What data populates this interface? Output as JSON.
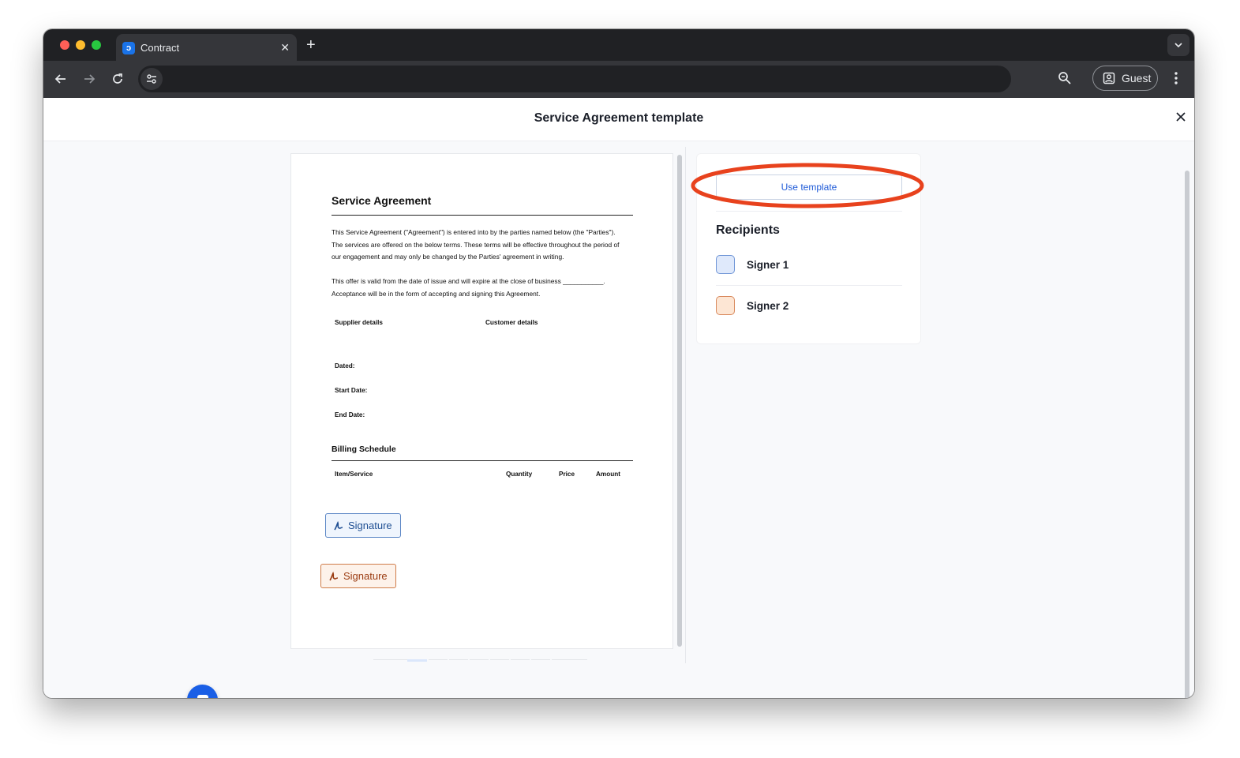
{
  "browser": {
    "tab_title": "Contract",
    "tab_favicon_glyph": "ɔ",
    "tab_close_glyph": "✕",
    "new_tab_glyph": "+",
    "address": "",
    "profile_label": "Guest"
  },
  "modal": {
    "title": "Service Agreement template"
  },
  "document": {
    "title": "Service Agreement",
    "intro_lines": [
      "This Service Agreement (\"Agreement\") is entered into by the parties named below (the \"Parties\").",
      "The services are offered on the below terms. These terms will be effective throughout the period of",
      "our engagement and may only be changed by the Parties' agreement in writing."
    ],
    "validity_lines": [
      "This offer is valid from the date of issue and will expire at the close of business ___________.",
      "Acceptance will be in the form of accepting and signing this Agreement."
    ],
    "supplier_label": "Supplier details",
    "customer_label": "Customer details",
    "dated_label": "Dated:",
    "start_date_label": "Start Date:",
    "end_date_label": "End Date:",
    "billing_title": "Billing Schedule",
    "billing_columns": [
      "Item/Service",
      "Quantity",
      "Price",
      "Amount"
    ],
    "signature_fields": [
      {
        "label": "Signature",
        "color": "#5b86c5"
      },
      {
        "label": "Signature",
        "color": "#cf7c49"
      }
    ]
  },
  "sidebar": {
    "use_template_label": "Use template",
    "recipients_heading": "Recipients",
    "signers": [
      {
        "name": "Signer 1",
        "color": "#dfe9fb",
        "border": "#6e94d6"
      },
      {
        "name": "Signer 2",
        "color": "#fde6d4",
        "border": "#d98a5e"
      }
    ]
  },
  "annotation": {
    "highlight_color": "#e8421d"
  }
}
